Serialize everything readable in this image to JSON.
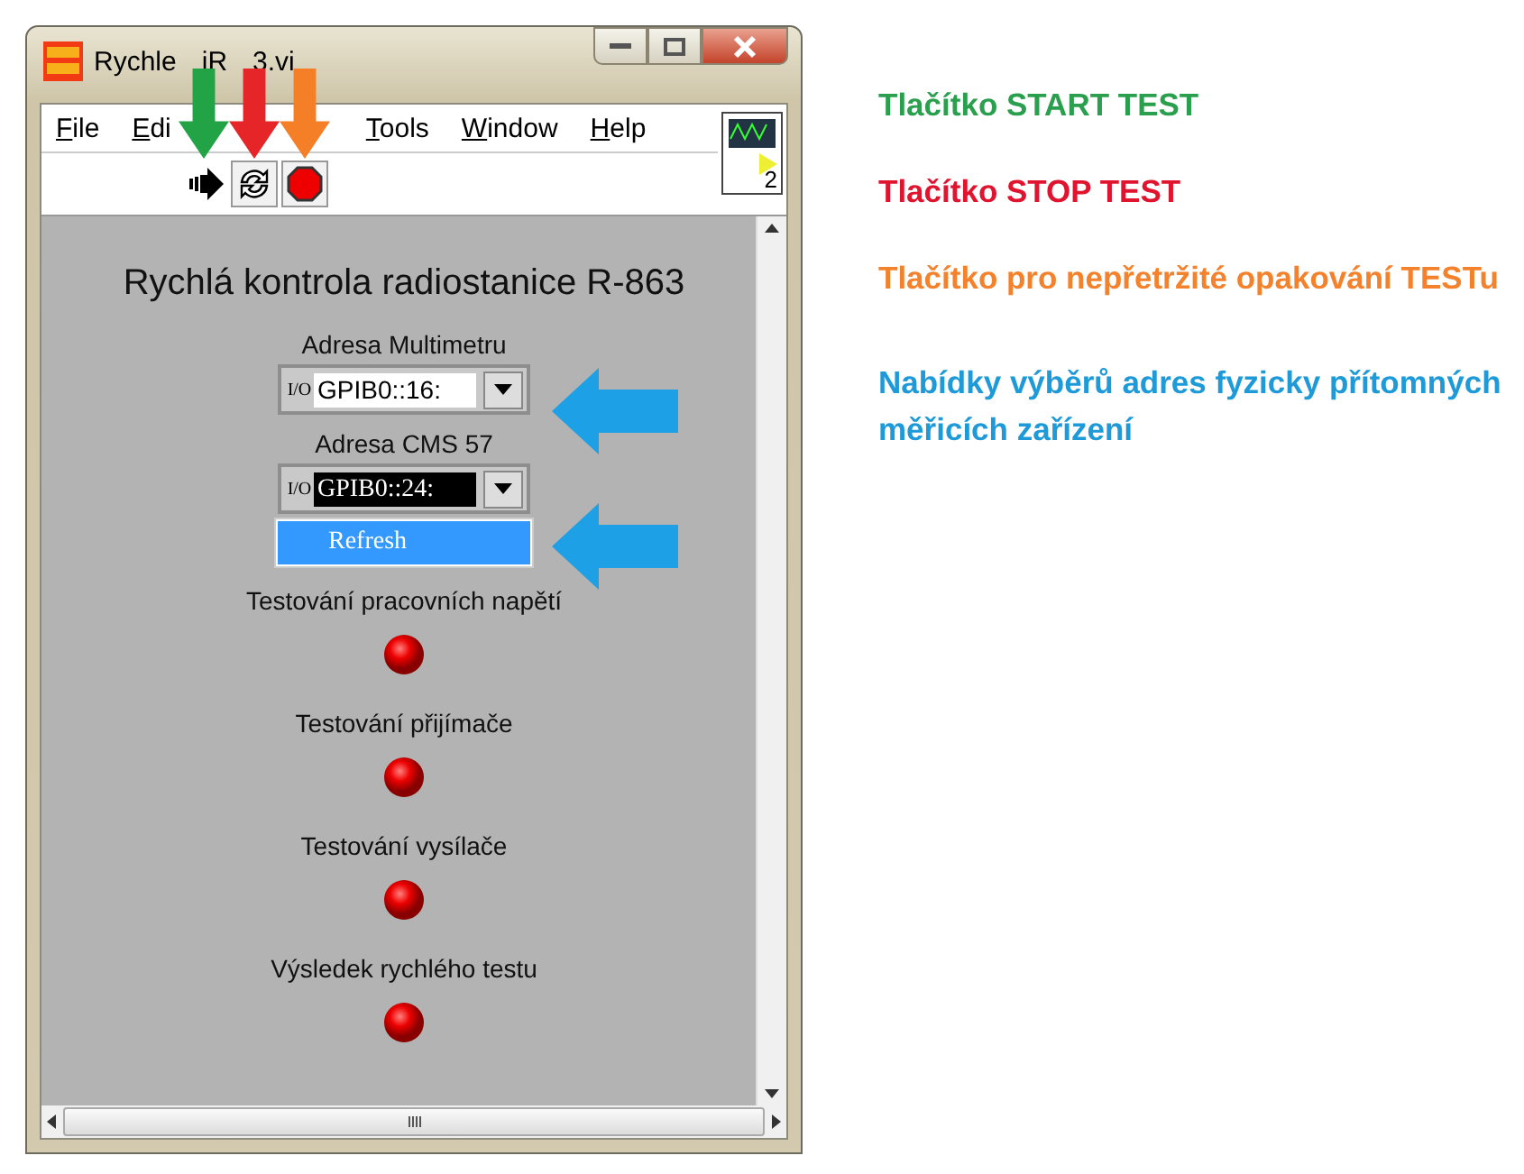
{
  "window": {
    "title_parts": [
      "Rychle",
      "iR",
      "3.vi"
    ]
  },
  "menu": [
    "File",
    "Edi",
    "Tools",
    "Window",
    "Help"
  ],
  "connector_pane": {
    "label": "2"
  },
  "panel": {
    "heading": "Rychlá kontrola radiostanice R-863",
    "selectors": [
      {
        "label": "Adresa Multimetru",
        "prefix": "I/O",
        "value": "GPIB0::16:",
        "highlighted": false
      },
      {
        "label": "Adresa CMS 57",
        "prefix": "I/O",
        "value": "GPIB0::24:",
        "highlighted": true
      }
    ],
    "dropdown_menu": [
      {
        "label": "Refresh",
        "selected": true
      }
    ],
    "indicators": [
      {
        "label": "Testování pracovních napětí"
      },
      {
        "label": "Testování přijímače"
      },
      {
        "label": "Testování vysílače"
      },
      {
        "label": "Výsledek rychlého testu"
      }
    ]
  },
  "toolbar_arrows": [
    {
      "color": "#21a346"
    },
    {
      "color": "#e52528"
    },
    {
      "color": "#f57f26"
    }
  ],
  "field_arrows": [
    {
      "color": "#1ea0e6"
    },
    {
      "color": "#1ea0e6"
    }
  ],
  "notes": [
    {
      "text": "Tlačítko START TEST",
      "color": "#2aa04e"
    },
    {
      "text": "Tlačítko STOP TEST",
      "color": "#e0142f"
    },
    {
      "text": "Tlačítko pro nepřetržité opakování TESTu",
      "color": "#f4822c"
    },
    {
      "text": "Nabídky výběrů adres fyzicky přítomných měřicích zařízení",
      "color": "#1e9ad8"
    }
  ]
}
